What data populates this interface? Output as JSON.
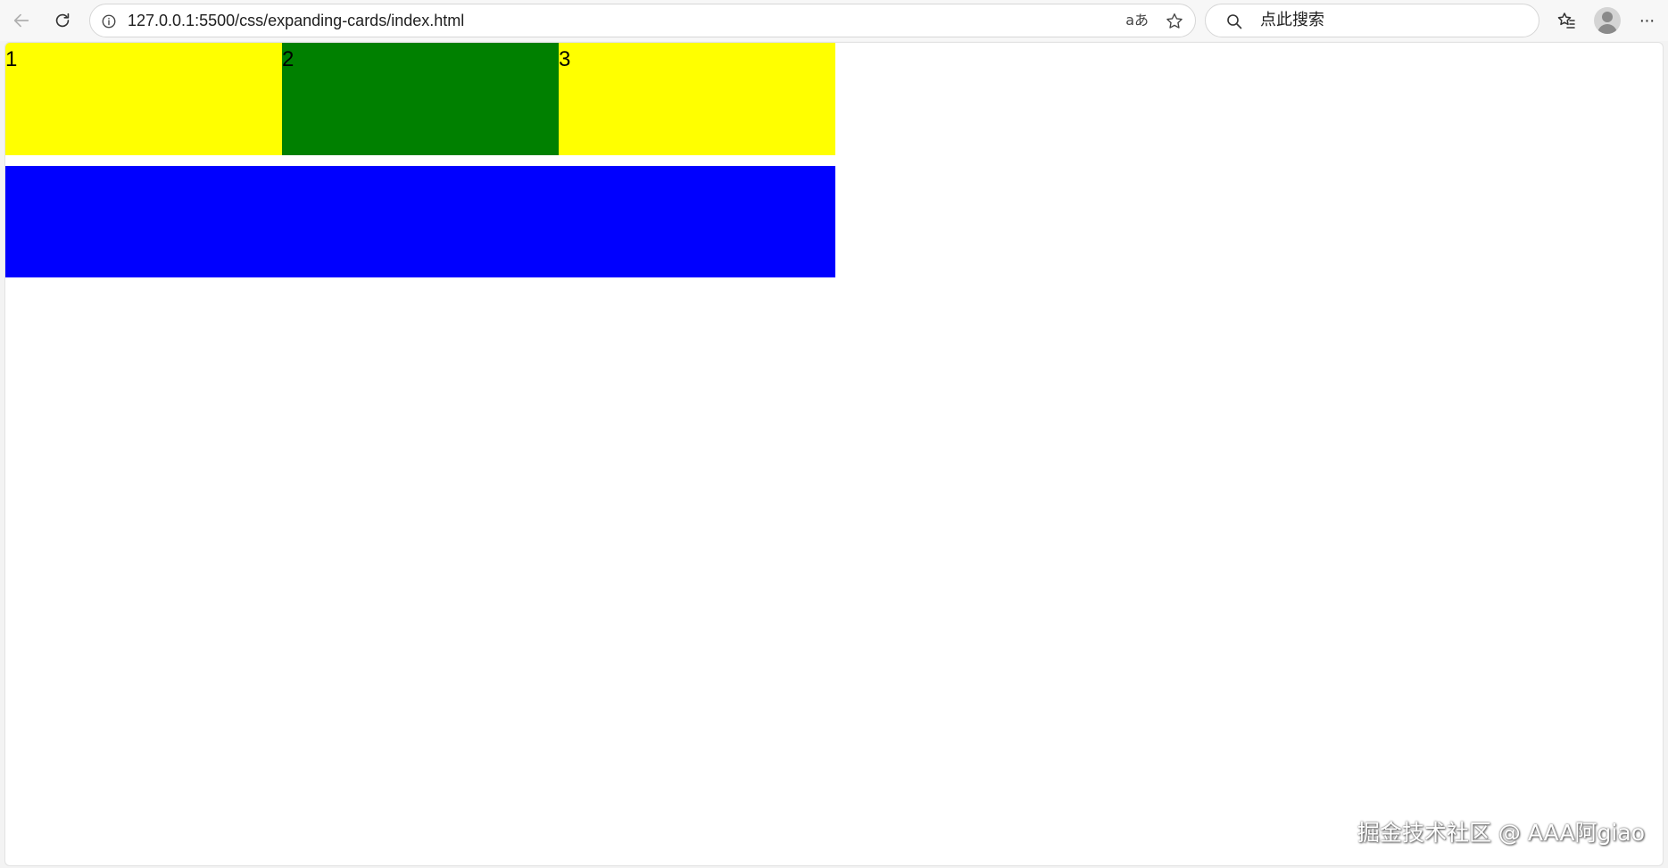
{
  "browser": {
    "url": "127.0.0.1:5500/css/expanding-cards/index.html",
    "read_aloud_glyph": "aあ",
    "search_placeholder": "点此搜索",
    "more_glyph": "···"
  },
  "page": {
    "cards": [
      {
        "label": "1",
        "color": "#ffff00"
      },
      {
        "label": "2",
        "color": "#008000"
      },
      {
        "label": "3",
        "color": "#ffff00"
      }
    ],
    "blue_box_color": "#0000ff"
  },
  "watermark": "掘金技术社区 @ AAA阿giao"
}
